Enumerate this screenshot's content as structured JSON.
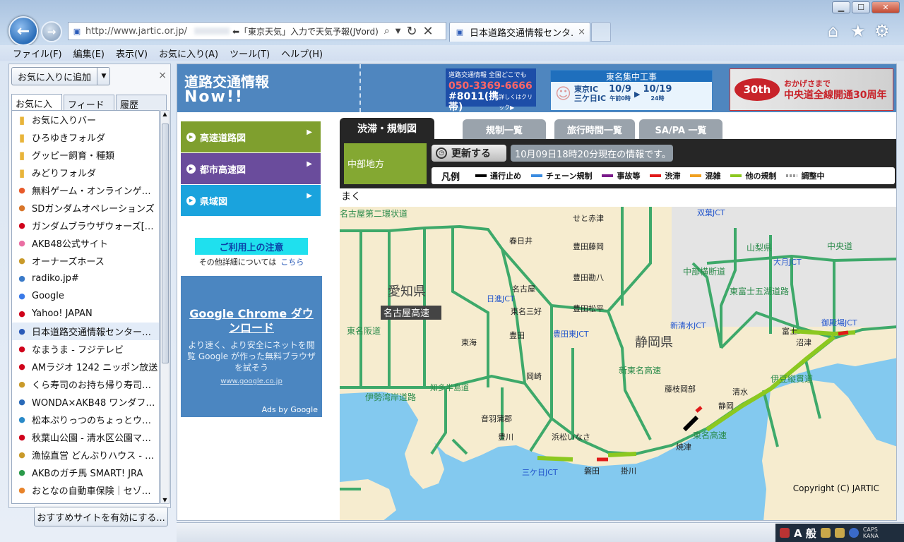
{
  "window": {
    "caption": {
      "minimize": "▁",
      "maximize": "☐",
      "close": "✕"
    }
  },
  "nav": {
    "url": "http://www.jartic.or.jp/",
    "search_hint": "⬅「東京天気」入力で天気予報(J∀ord)",
    "tab_title": "日本道路交通情報センタ...",
    "tab_close": "×"
  },
  "menu": [
    "ファイル(F)",
    "編集(E)",
    "表示(V)",
    "お気に入り(A)",
    "ツール(T)",
    "ヘルプ(H)"
  ],
  "favorites": {
    "add_label": "お気に入りに追加",
    "close": "×",
    "tabs": [
      "お気に入り",
      "フィード",
      "履歴"
    ],
    "items": [
      {
        "label": "お気に入りバー",
        "icon": "folder-icon",
        "color": "#e8b43a"
      },
      {
        "label": "ひろゆきフォルダ",
        "icon": "folder-icon",
        "color": "#e8b43a"
      },
      {
        "label": "グッピー飼育・種類",
        "icon": "folder-icon",
        "color": "#e8b43a"
      },
      {
        "label": "みどりフォルダ",
        "icon": "folder-icon",
        "color": "#e8b43a"
      },
      {
        "label": "無料ゲーム・オンラインゲー...",
        "icon": "g-icon",
        "color": "#e85a2a"
      },
      {
        "label": "SDガンダムオペレーションズ",
        "icon": "sd-icon",
        "color": "#d8752a"
      },
      {
        "label": "ガンダムブラウザウォーズ[ゲ...",
        "icon": "yahoo-icon",
        "color": "#d0021b"
      },
      {
        "label": "AKB48公式サイト",
        "icon": "akb-icon",
        "color": "#ea6fa3"
      },
      {
        "label": "オーナーズホース",
        "icon": "horse-icon",
        "color": "#c99a2a"
      },
      {
        "label": "radiko.jp#",
        "icon": "radiko-icon",
        "color": "#3a7ac8"
      },
      {
        "label": "Google",
        "icon": "google-icon",
        "color": "#3a7ae8"
      },
      {
        "label": "Yahoo! JAPAN",
        "icon": "yahoo-icon",
        "color": "#d0021b"
      },
      {
        "label": "日本道路交通情報センター：J...",
        "icon": "jartic-icon",
        "color": "#2a5ab8"
      },
      {
        "label": "なまうま - フジテレビ",
        "icon": "fuji-icon",
        "color": "#d0021b"
      },
      {
        "label": "AMラジオ 1242 ニッポン放送",
        "icon": "fuji-icon",
        "color": "#d0021b"
      },
      {
        "label": "くら寿司のお持ち帰り寿司｜...",
        "icon": "kura-icon",
        "color": "#c99a2a"
      },
      {
        "label": "WONDA×AKB48 ワンダフル ...",
        "icon": "globe-icon",
        "color": "#2a6ab8"
      },
      {
        "label": "松本ぷりっつのちょっとウマ...",
        "icon": "blog-icon",
        "color": "#2a8ac8"
      },
      {
        "label": "秋葉山公園 - 清水区公園マッ...",
        "icon": "yahoo-icon",
        "color": "#d0021b"
      },
      {
        "label": "漁協直営 どんぶりハウス - 安...",
        "icon": "fish-icon",
        "color": "#c99a2a"
      },
      {
        "label": "AKBのガチ馬 SMART! JRA",
        "icon": "jra-icon",
        "color": "#2a9a4a"
      },
      {
        "label": "おとなの自動車保険｜セゾン...",
        "icon": "saison-icon",
        "color": "#e8832a"
      }
    ],
    "recommend_button": "おすすめサイトを有効にする..."
  },
  "site": {
    "title_line1": "道路交通情報",
    "title_line2": "Now!!",
    "banner1": {
      "line1": "道路交通情報 全国どこでも",
      "phone": "050-3369-6666",
      "line3": "#8011(携帯)",
      "note": "詳しくはクリック▶"
    },
    "banner2": {
      "title": "東名集中工事",
      "from": "東京IC",
      "to": "三ケ日IC",
      "start": "10/9",
      "end": "10/19",
      "start_note": "午前0時",
      "end_note": "24時"
    },
    "banner3": {
      "logo": "30th",
      "text1": "おかげさまで",
      "text2": "中央道全線開通30周年"
    },
    "sidenav": [
      {
        "label": "高速道路図",
        "color": "#7f9f2e"
      },
      {
        "label": "都市高速図",
        "color": "#6a4c9c"
      },
      {
        "label": "県域図",
        "color": "#1aa3dd"
      }
    ],
    "notice_title": "ご利用上の注意",
    "notice_text": "その他詳細については",
    "notice_link": "こちら",
    "ad": {
      "title": "Google Chrome ダウンロード",
      "body": "より速く、より安全にネットを閲覧 Google が作った無料ブラウザを試そう",
      "url": "www.google.co.jp",
      "ads_by": "Ads by Google"
    },
    "content_tabs": [
      "渋滞・規制図",
      "規制一覧",
      "旅行時間一覧",
      "SA/PA 一覧"
    ],
    "region": "中部地方",
    "update_button": "更新する",
    "timestamp": "10月09日18時20分現在の情報です。",
    "legend_title": "凡例",
    "legend": [
      {
        "label": "通行止め",
        "color": "#000000"
      },
      {
        "label": "チェーン規制",
        "color": "#3a8be0"
      },
      {
        "label": "事故等",
        "color": "#7a1a8a"
      },
      {
        "label": "渋滞",
        "color": "#e01a1a"
      },
      {
        "label": "混雑",
        "color": "#f0a020"
      },
      {
        "label": "他の規制",
        "color": "#8cc820"
      },
      {
        "label": "調整中",
        "color": "#999999"
      }
    ],
    "cut_text": "まく",
    "copyright": "Copyright (C) JARTIC",
    "map_labels": {
      "aichi": "愛知県",
      "shizuoka": "静岡県",
      "nagoya": "名古屋高速",
      "yamanashi": "山梨県",
      "tomei": "東名高速",
      "shin_tomei": "新東名高速",
      "isewan": "伊勢湾岸道路",
      "izu": "伊豆縦貫道",
      "chuo": "中央道",
      "chubu": "中部横断道",
      "higashi_fuji": "東富士五湖道路",
      "tomei_hantou": "東名阪道",
      "nagoya2": "名古屋第二環状道",
      "toyota_jct": "豊田東JCT",
      "mikkabi_jct": "三ケ日JCT",
      "shin_shimizu_jct": "新清水JCT",
      "gotemba_jct": "御殿場JCT",
      "otsuki_jct": "大月JCT",
      "soryu_jct": "双葉JCT",
      "toyota": "豊田",
      "okazaki": "岡崎",
      "hamamatsu": "浜松いなさ",
      "fuji": "富士",
      "numazu": "沼津",
      "shimizu": "清水",
      "shizuoka_city": "静岡",
      "yaizu": "焼津",
      "fujieda": "藤枝岡部",
      "kakegawa": "掛川",
      "iwata": "磐田",
      "chita": "知多半島道",
      "kasugai": "春日井",
      "seto": "せと赤津",
      "toyota_fujioka": "豊田藤岡",
      "toyota_kanpachi": "豊田勘八",
      "toyota_matsudaira": "豊田松平",
      "higashi_nagoya": "東名三好",
      "meito": "名古屋",
      "nisshin": "日進JCT",
      "tokai": "東海",
      "kouta": "音羽蒲郡",
      "toyokawa": "豊川"
    }
  }
}
